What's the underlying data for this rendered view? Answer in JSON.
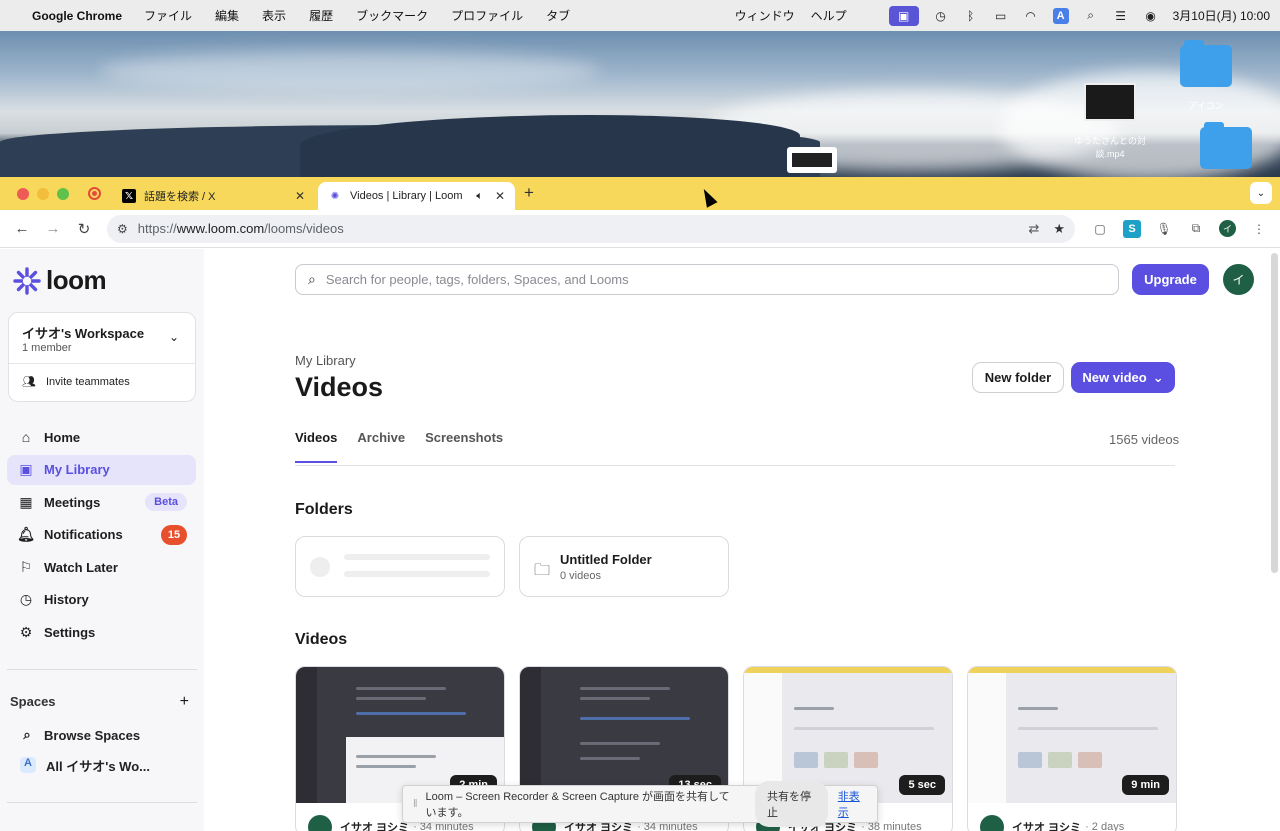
{
  "menubar": {
    "app": "Google Chrome",
    "items": [
      "ファイル",
      "編集",
      "表示",
      "履歴",
      "ブックマーク",
      "プロファイル",
      "タブ"
    ],
    "right_items": [
      "ウィンドウ",
      "ヘルプ"
    ],
    "clock": "3月10日(月)  10:00",
    "input_indicator": "A"
  },
  "desktop": {
    "icons": [
      {
        "label": "アイコン"
      },
      {
        "label": "ゆうたさんとの対談.mp4"
      }
    ]
  },
  "browser": {
    "tabs": [
      {
        "title": "話題を検索 / X",
        "favicon": "x-icon"
      },
      {
        "title": "Videos | Library | Loom",
        "favicon": "loom-icon"
      }
    ],
    "url_prefix": "https://",
    "url_host": "www.loom.com",
    "url_path": "/looms/videos",
    "profile_initial": "イ"
  },
  "sidebar": {
    "logo": "loom",
    "workspace": {
      "name": "イサオ's Workspace",
      "members": "1 member",
      "invite": "Invite teammates"
    },
    "nav": [
      {
        "label": "Home",
        "icon": "home-icon"
      },
      {
        "label": "My Library",
        "icon": "library-icon"
      },
      {
        "label": "Meetings",
        "icon": "calendar-icon",
        "badge": "Beta"
      },
      {
        "label": "Notifications",
        "icon": "bell-icon",
        "count": "15"
      },
      {
        "label": "Watch Later",
        "icon": "bookmark-icon"
      },
      {
        "label": "History",
        "icon": "history-icon"
      },
      {
        "label": "Settings",
        "icon": "gear-icon"
      }
    ],
    "spaces_header": "Spaces",
    "spaces": [
      {
        "label": "Browse Spaces"
      },
      {
        "label": "All イサオ's Wo...",
        "initial": "A"
      }
    ]
  },
  "main": {
    "search_placeholder": "Search for people, tags, folders, Spaces, and Looms",
    "upgrade": "Upgrade",
    "avatar_initial": "イ",
    "breadcrumb": "My Library",
    "title": "Videos",
    "new_folder": "New folder",
    "new_video": "New video",
    "tabs": [
      "Videos",
      "Archive",
      "Screenshots"
    ],
    "video_count": "1565 videos",
    "folders_header": "Folders",
    "folder": {
      "name": "Untitled Folder",
      "count": "0 videos"
    },
    "videos_header": "Videos",
    "videos": [
      {
        "duration": "2 min",
        "author": "イサオ ヨシミ",
        "time": "· 34 minutes"
      },
      {
        "duration": "13 sec",
        "author": "イサオ ヨシミ",
        "time": "· 34 minutes"
      },
      {
        "duration": "5 sec",
        "author": "イサオ ヨシミ",
        "time": "· 38 minutes"
      },
      {
        "duration": "9 min",
        "author": "イサオ ヨシミ",
        "time": "· 2 days"
      }
    ]
  },
  "share_bar": {
    "message": "Loom – Screen Recorder & Screen Capture が画面を共有しています。",
    "stop": "共有を停止",
    "hide": "非表示"
  },
  "colors": {
    "accent": "#5a4fe0",
    "tab_bar": "#f7d85a",
    "badge": "#e84f2d"
  }
}
